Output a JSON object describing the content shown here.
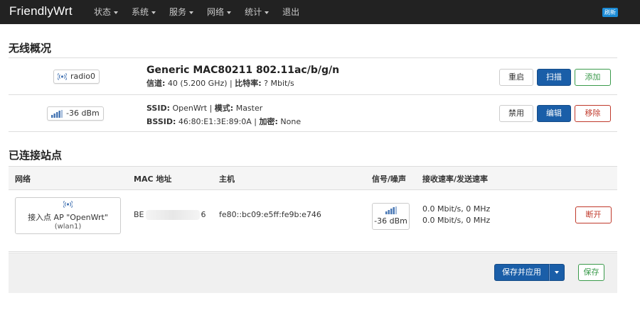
{
  "app": {
    "brand": "FriendlyWrt",
    "refresh_badge": "刷新"
  },
  "nav": {
    "items": [
      {
        "label": "状态",
        "dropdown": true
      },
      {
        "label": "系统",
        "dropdown": true
      },
      {
        "label": "服务",
        "dropdown": true
      },
      {
        "label": "网络",
        "dropdown": true
      },
      {
        "label": "统计",
        "dropdown": true
      },
      {
        "label": "退出",
        "dropdown": false
      }
    ]
  },
  "wireless": {
    "heading": "无线概况",
    "radio": {
      "badge": "radio0",
      "title": "Generic MAC80211 802.11ac/b/g/n",
      "channel_label": "信道:",
      "channel_value": "40 (5.200 GHz)",
      "bitrate_label": "比特率:",
      "bitrate_value": "? Mbit/s",
      "buttons": {
        "restart": "重启",
        "scan": "扫描",
        "add": "添加"
      }
    },
    "network": {
      "signal_badge": "-36 dBm",
      "ssid_label": "SSID:",
      "ssid_value": "OpenWrt",
      "mode_label": "模式:",
      "mode_value": "Master",
      "bssid_label": "BSSID:",
      "bssid_value": "46:80:E1:3E:89:0A",
      "encryption_label": "加密:",
      "encryption_value": "None",
      "buttons": {
        "disable": "禁用",
        "edit": "编辑",
        "remove": "移除"
      }
    }
  },
  "stations": {
    "heading": "已连接站点",
    "columns": {
      "network": "网络",
      "mac": "MAC 地址",
      "host": "主机",
      "signal": "信号/噪声",
      "rates": "接收速率/发送速率"
    },
    "rows": [
      {
        "ap_label": "接入点 AP \"OpenWrt\"",
        "interface": "(wlan1)",
        "mac_prefix": "BE",
        "mac_suffix": "6",
        "host": "fe80::bc09:e5ff:fe9b:e746",
        "signal": "-36 dBm",
        "rx": "0.0 Mbit/s, 0 MHz",
        "tx": "0.0 Mbit/s, 0 MHz",
        "disconnect": "断开"
      }
    ]
  },
  "footer": {
    "save_apply": "保存并应用",
    "save": "保存"
  },
  "colors": {
    "navbar": "#222222",
    "primary": "#1a5ea8",
    "add": "#3a9a4b",
    "remove": "#c0392b",
    "badge": "#1b8bd6"
  }
}
